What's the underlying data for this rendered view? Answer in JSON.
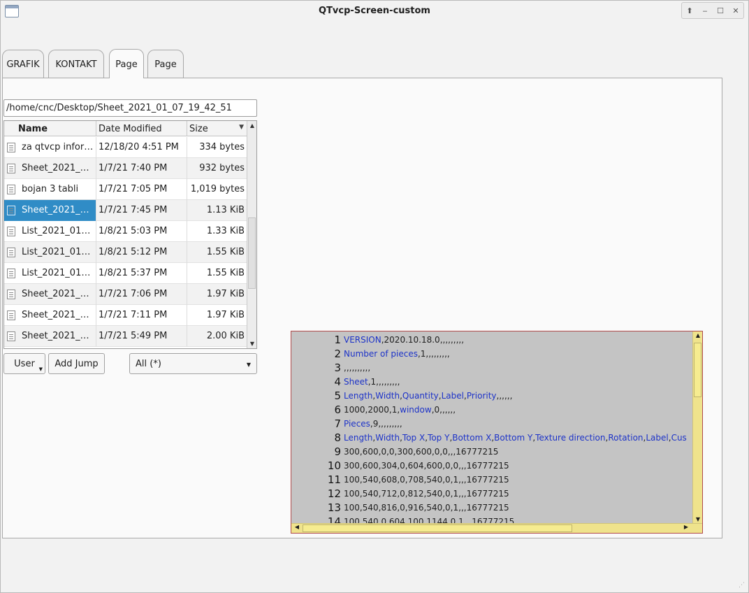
{
  "window": {
    "title": "QTvcp-Screen-custom"
  },
  "tabs": [
    {
      "label": "GRAFIK"
    },
    {
      "label": "KONTAKT"
    },
    {
      "label": "Page"
    },
    {
      "label": "Page"
    }
  ],
  "file_browser": {
    "path": "/home/cnc/Desktop/Sheet_2021_01_07_19_42_51",
    "columns": [
      "Name",
      "Date Modified",
      "Size"
    ],
    "rows": [
      {
        "name": "za qtvcp infor…",
        "date": "12/18/20 4:51 PM",
        "size": "334 bytes"
      },
      {
        "name": "Sheet_2021_…",
        "date": "1/7/21 7:40 PM",
        "size": "932 bytes"
      },
      {
        "name": "bojan 3 tabli",
        "date": "1/7/21 7:05 PM",
        "size": "1,019 bytes"
      },
      {
        "name": "Sheet_2021_…",
        "date": "1/7/21 7:45 PM",
        "size": "1.13 KiB",
        "selected": true
      },
      {
        "name": "List_2021_01…",
        "date": "1/8/21 5:03 PM",
        "size": "1.33 KiB"
      },
      {
        "name": "List_2021_01…",
        "date": "1/8/21 5:12 PM",
        "size": "1.55 KiB"
      },
      {
        "name": "List_2021_01…",
        "date": "1/8/21 5:37 PM",
        "size": "1.55 KiB"
      },
      {
        "name": "Sheet_2021_…",
        "date": "1/7/21 7:06 PM",
        "size": "1.97 KiB"
      },
      {
        "name": "Sheet_2021_…",
        "date": "1/7/21 7:11 PM",
        "size": "1.97 KiB"
      },
      {
        "name": "Sheet_2021_…",
        "date": "1/7/21 5:49 PM",
        "size": "2.00 KiB"
      }
    ],
    "user_button": "User",
    "add_jump_button": "Add Jump",
    "filter": "All (*)"
  },
  "editor": {
    "lines": [
      {
        "n": "1",
        "kw": [
          "VERSION"
        ],
        "text": "VERSION,2020.10.18.0,,,,,,,,,"
      },
      {
        "n": "2",
        "text": "Number of pieces,1,,,,,,,,,"
      },
      {
        "n": "3",
        "text": ",,,,,,,,,,"
      },
      {
        "n": "4",
        "text": "Sheet,1,,,,,,,,,"
      },
      {
        "n": "5",
        "text": "Length,Width,Quantity,Label,Priority,,,,,,"
      },
      {
        "n": "6",
        "text": "1000,2000,1,window,0,,,,,,"
      },
      {
        "n": "7",
        "text": "Pieces,9,,,,,,,,,"
      },
      {
        "n": "8",
        "text": "Length,Width,Top X,Top Y,Bottom X,Bottom Y,Texture direction,Rotation,Label,Cus"
      },
      {
        "n": "9",
        "text": "300,600,0,0,300,600,0,0,,,16777215"
      },
      {
        "n": "10",
        "text": "300,600,304,0,604,600,0,0,,,16777215"
      },
      {
        "n": "11",
        "text": "100,540,608,0,708,540,0,1,,,16777215"
      },
      {
        "n": "12",
        "text": "100,540,712,0,812,540,0,1,,,16777215"
      },
      {
        "n": "13",
        "text": "100,540,816,0,916,540,0,1,,,16777215"
      },
      {
        "n": "14",
        "text": "100,540,0,604,100,1144,0,1,,,16777215"
      }
    ],
    "keywords": [
      "VERSION",
      "Number of pieces",
      "Sheet",
      "Length",
      "Width",
      "Quantity",
      "Label",
      "Priority",
      "window",
      "Pieces",
      "Top X",
      "Top Y",
      "Bottom X",
      "Bottom Y",
      "Texture direction",
      "Rotation",
      "Cus"
    ],
    "colors": {
      "background": "#c4c4c4",
      "keyword": "#1d33c8",
      "scrollbar": "#efe38c"
    }
  },
  "colors": {
    "selection": "#308cc6"
  }
}
